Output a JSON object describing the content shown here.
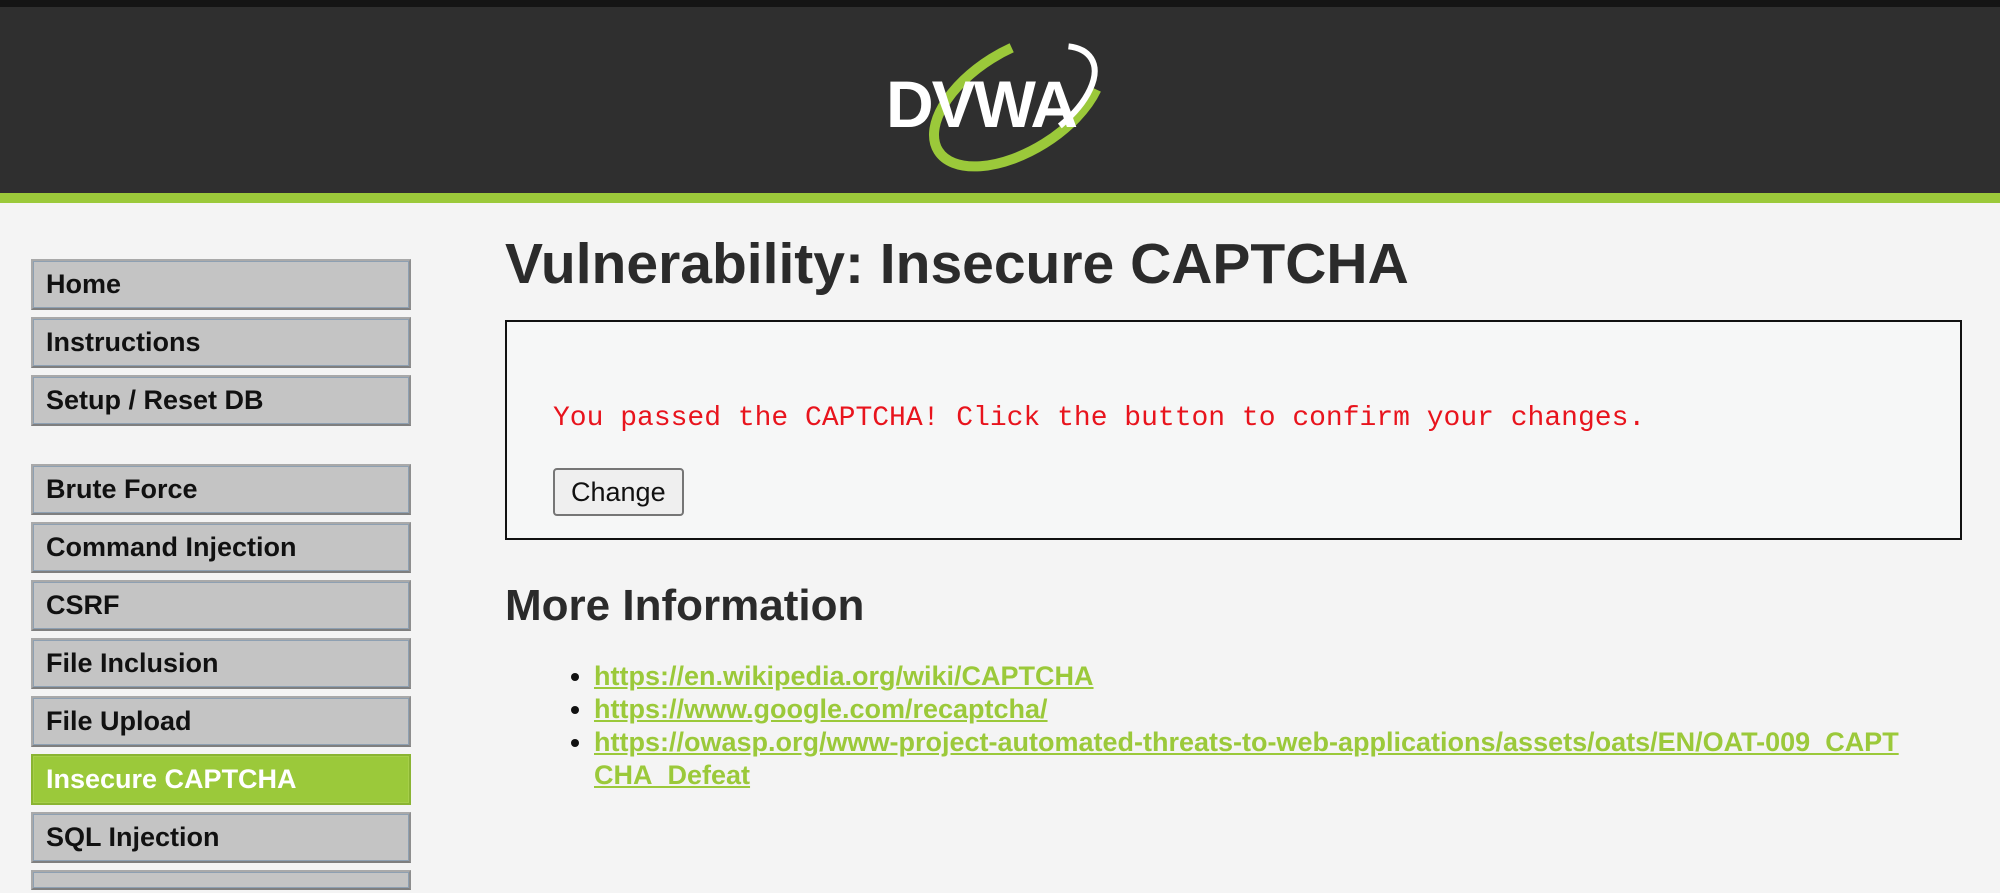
{
  "header": {
    "logo_text": "DVWA",
    "colors": {
      "background": "#2f2f2f",
      "accent": "#9bc93a"
    }
  },
  "sidebar": {
    "groups": [
      {
        "items": [
          {
            "label": "Home"
          },
          {
            "label": "Instructions"
          },
          {
            "label": "Setup / Reset DB"
          }
        ]
      },
      {
        "items": [
          {
            "label": "Brute Force"
          },
          {
            "label": "Command Injection"
          },
          {
            "label": "CSRF"
          },
          {
            "label": "File Inclusion"
          },
          {
            "label": "File Upload"
          },
          {
            "label": "Insecure CAPTCHA",
            "active": true
          },
          {
            "label": "SQL Injection"
          }
        ]
      }
    ]
  },
  "main": {
    "title": "Vulnerability: Insecure CAPTCHA",
    "message": "You passed the CAPTCHA! Click the button to confirm your changes.",
    "message_color": "#e8141d",
    "change_button": "Change",
    "more_info_title": "More Information",
    "links": [
      "https://en.wikipedia.org/wiki/CAPTCHA",
      "https://www.google.com/recaptcha/",
      "https://owasp.org/www-project-automated-threats-to-web-applications/assets/oats/EN/OAT-009_CAPTCHA_Defeat"
    ]
  }
}
